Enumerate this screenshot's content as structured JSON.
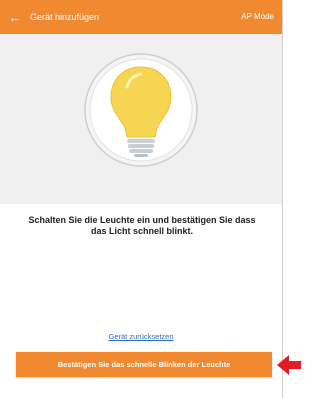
{
  "header": {
    "back_icon": "←",
    "title": "Gerät hinzufügen",
    "mode": "AP Mode"
  },
  "hero": {
    "icon": "lightbulb-icon"
  },
  "instruction": "Schalten Sie die Leuchte ein und bestätigen Sie dass das Licht schnell blinkt.",
  "reset_link": "Gerät zurücksetzen",
  "confirm_button": "Bestätigen Sie das schnelle Blinken der Leuchte",
  "colors": {
    "accent": "#f0892f",
    "link": "#2d6fb5",
    "annotation": "#e31b23",
    "bulb": "#f6d552"
  }
}
